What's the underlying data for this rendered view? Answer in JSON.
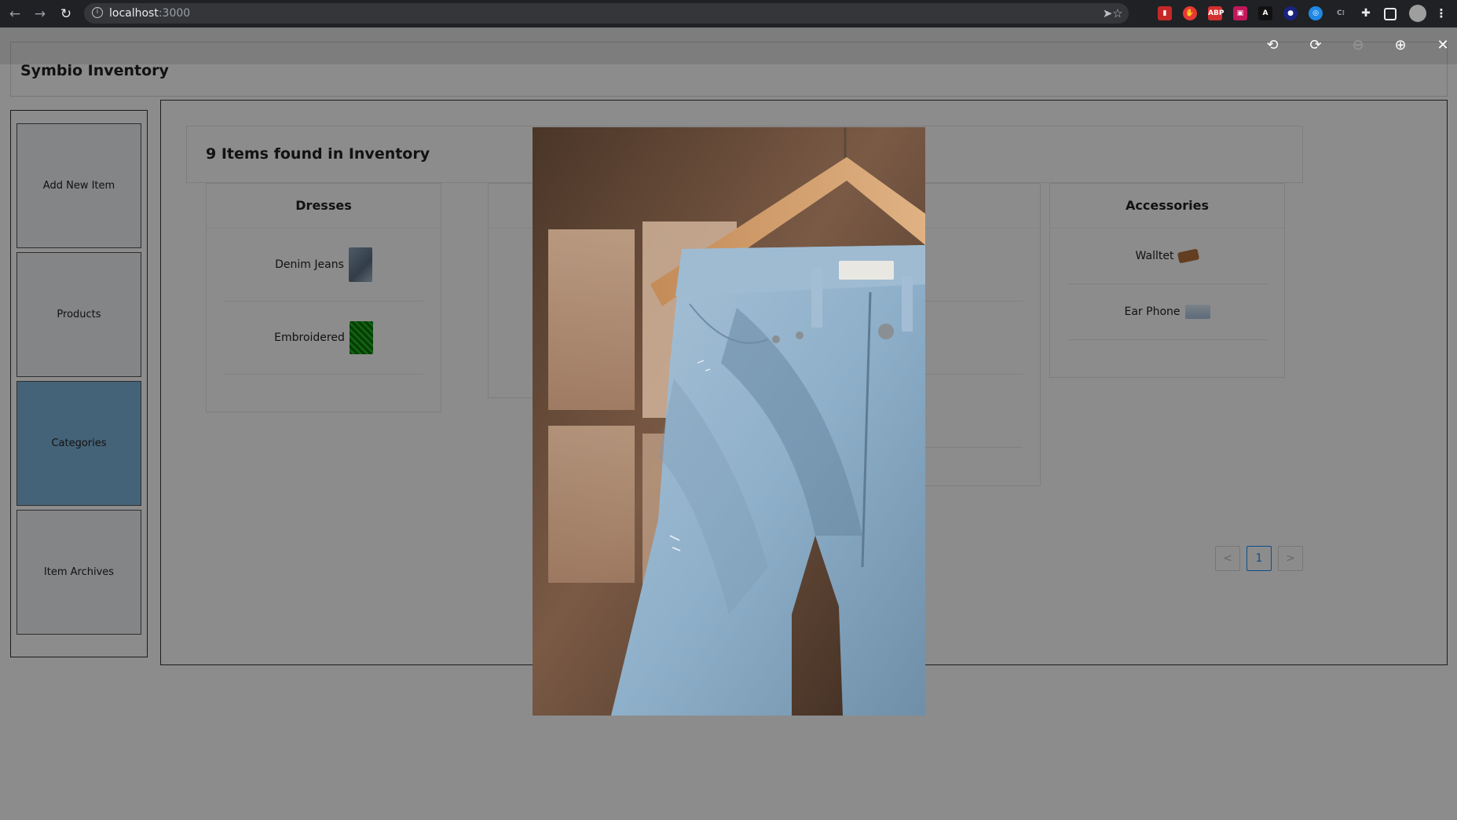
{
  "browser": {
    "url_host": "localhost",
    "url_port": ":3000",
    "back_icon": "arrow-left-icon",
    "forward_icon": "arrow-right-icon",
    "reload_icon": "reload-icon"
  },
  "app": {
    "title": "Symbio Inventory"
  },
  "sidebar": {
    "items": [
      {
        "label": "Add New Item",
        "active": false
      },
      {
        "label": "Products",
        "active": false
      },
      {
        "label": "Categories",
        "active": true
      },
      {
        "label": "Item Archives",
        "active": false
      }
    ]
  },
  "main": {
    "count_text": "9 Items found in Inventory",
    "categories": [
      {
        "title": "Dresses",
        "items": [
          {
            "name": "Denim Jeans",
            "thumb": "denim-thumb"
          },
          {
            "name": "Embroidered",
            "thumb": "green-fabric-thumb"
          }
        ]
      },
      {
        "title": "Accessories",
        "items": [
          {
            "name": "Walltet",
            "thumb": "wallet-thumb"
          },
          {
            "name": "Ear Phone",
            "thumb": "earphone-thumb"
          }
        ]
      }
    ],
    "pagination": {
      "prev": "<",
      "current": "1",
      "next": ">"
    }
  },
  "viewer": {
    "tools": [
      "rotate-left-icon",
      "rotate-right-icon",
      "zoom-out-icon",
      "zoom-in-icon",
      "close-icon"
    ],
    "image_subject": "denim-jeans-on-hanger"
  }
}
